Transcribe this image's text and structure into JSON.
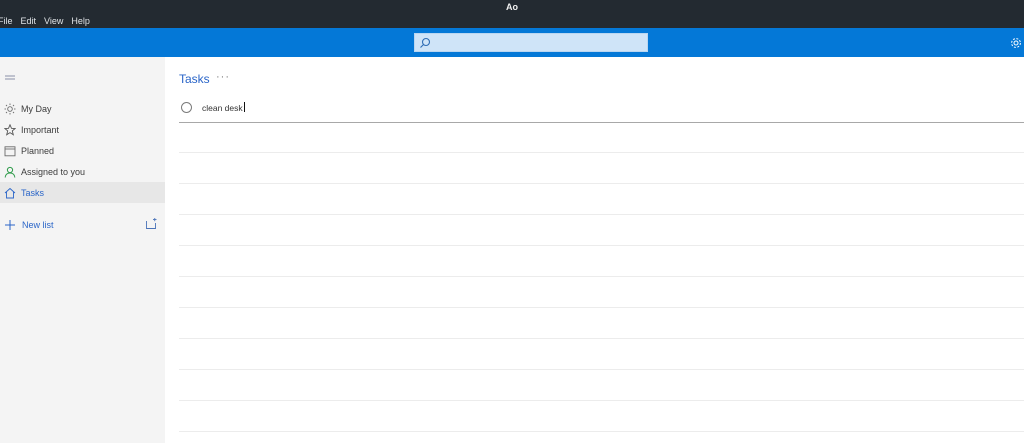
{
  "titlebar": {
    "title": "Ao"
  },
  "menu": {
    "items": [
      "File",
      "Edit",
      "View",
      "Help"
    ]
  },
  "search": {
    "icon": "search-icon",
    "placeholder": ""
  },
  "toolbar": {
    "settings_icon": "gear-icon"
  },
  "sidebar": {
    "items": [
      {
        "label": "My Day",
        "icon": "sun-icon"
      },
      {
        "label": "Important",
        "icon": "star-icon"
      },
      {
        "label": "Planned",
        "icon": "calendar-icon"
      },
      {
        "label": "Assigned to you",
        "icon": "person-icon"
      },
      {
        "label": "Tasks",
        "icon": "home-icon",
        "active": true
      }
    ],
    "new_list": "New list"
  },
  "main": {
    "title": "Tasks",
    "more": "···",
    "task_input": "clean desk"
  },
  "colors": {
    "accent": "#0478d7",
    "active_text": "#2a65c8",
    "titlebar": "#232a31"
  }
}
